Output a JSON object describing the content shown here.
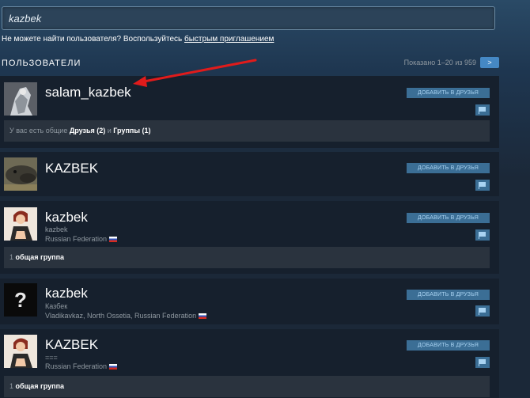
{
  "search": {
    "value": "kazbek"
  },
  "hint": {
    "text": "Не можете найти пользователя? Воспользуйтесь ",
    "link": "быстрым приглашением"
  },
  "section": {
    "title": "ПОЛЬЗОВАТЕЛИ"
  },
  "paging": {
    "text": "Показано 1–20 из 959",
    "next_label": ">"
  },
  "colors": {
    "background": "#1b2838",
    "card": "#16202d",
    "button": "#3b6e95",
    "arrow": "#e01b1b"
  },
  "users": [
    {
      "name": "salam_kazbek",
      "add_label": "ДОБАВИТЬ В ДРУЗЬЯ",
      "common": {
        "prefix": "У вас есть общие ",
        "friends": "Друзья (2)",
        "and": " и ",
        "groups": "Группы (1)"
      }
    },
    {
      "name": "KAZBEK",
      "add_label": "ДОБАВИТЬ В ДРУЗЬЯ"
    },
    {
      "name": "kazbek",
      "real_name": "kazbek",
      "location": "Russian Federation",
      "add_label": "ДОБАВИТЬ В ДРУЗЬЯ",
      "common": {
        "count": "1",
        "groups": " общая группа"
      }
    },
    {
      "name": "kazbek",
      "real_name": "Казбек",
      "location": "Vladikavkaz, North Ossetia, Russian Federation",
      "add_label": "ДОБАВИТЬ В ДРУЗЬЯ",
      "avatar_placeholder": "?"
    },
    {
      "name": "KAZBEK",
      "real_name": "===",
      "location": "Russian Federation",
      "add_label": "ДОБАВИТЬ В ДРУЗЬЯ",
      "common": {
        "count": "1",
        "groups": " общая группа"
      }
    }
  ]
}
